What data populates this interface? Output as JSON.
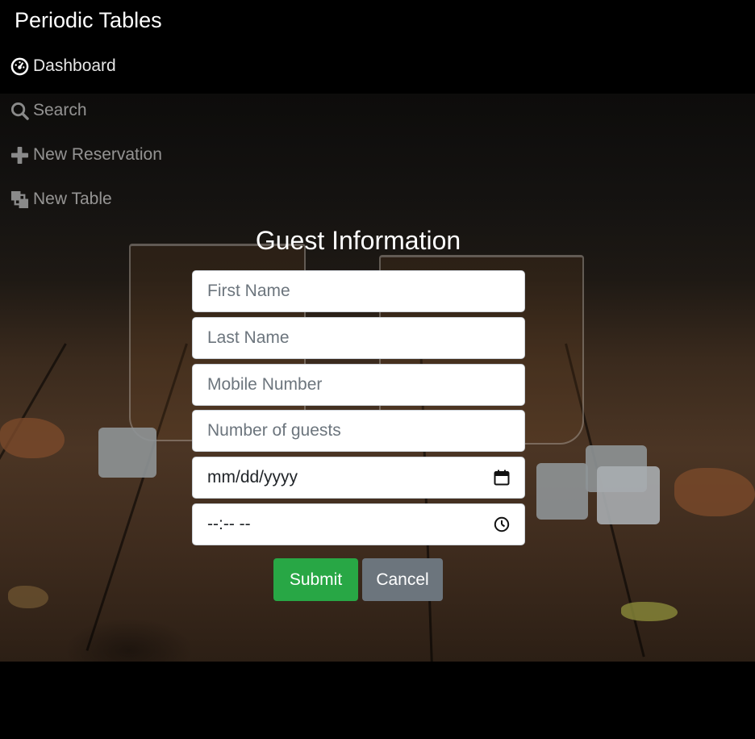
{
  "app": {
    "title": "Periodic Tables"
  },
  "nav": {
    "items": [
      {
        "label": "Dashboard",
        "icon": "dashboard-icon"
      },
      {
        "label": "Search",
        "icon": "search-icon"
      },
      {
        "label": "New Reservation",
        "icon": "plus-icon"
      },
      {
        "label": "New Table",
        "icon": "layers-icon"
      }
    ]
  },
  "form": {
    "title": "Guest Information",
    "first_name": {
      "placeholder": "First Name",
      "value": ""
    },
    "last_name": {
      "placeholder": "Last Name",
      "value": ""
    },
    "mobile_number": {
      "placeholder": "Mobile Number",
      "value": ""
    },
    "people": {
      "placeholder": "Number of guests",
      "value": ""
    },
    "date": {
      "display": "mm/dd/yyyy",
      "icon": "calendar-icon"
    },
    "time": {
      "display": "--:-- --",
      "icon": "clock-icon"
    },
    "submit_label": "Submit",
    "cancel_label": "Cancel"
  },
  "colors": {
    "submit": "#28a745",
    "cancel": "#6c757d",
    "header": "#000000"
  }
}
